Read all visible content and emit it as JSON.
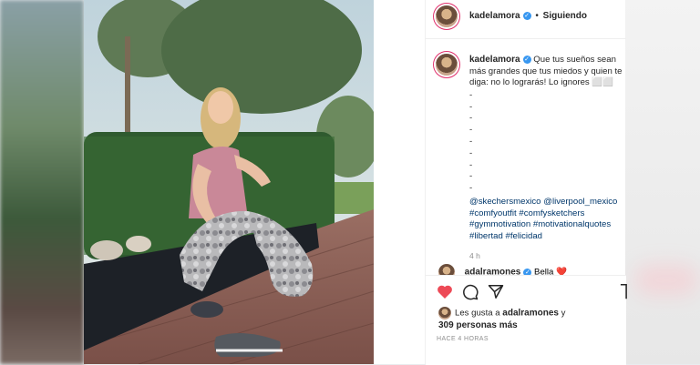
{
  "post": {
    "username": "kadelamora",
    "follow_status": "Siguiendo",
    "separator": "•",
    "verified_mark": "✓",
    "caption_text": "Que tus sueños sean más grandes que tus miedos y quien te diga: no lo lograrás! Lo ignores ⬜⬜",
    "dashes": [
      "-",
      "-",
      "-",
      "-",
      "-",
      "-",
      "-",
      "-",
      "-"
    ],
    "mentions": [
      "@skechersmexico",
      "@liverpool_mexico"
    ],
    "hashtags_line1": [
      "#comfyoutfit",
      "#comfysketchers"
    ],
    "hashtags_line2": [
      "#gymmotivation",
      "#motivationalquotes"
    ],
    "hashtags_line3": [
      "#libertad",
      "#felicidad"
    ],
    "time_ago_short": "4 h"
  },
  "comment": {
    "username": "adalramones",
    "text": "Bella",
    "emojis": "❤️"
  },
  "likes": {
    "prefix": "Les gusta a",
    "liker": "adalramones",
    "conj": "y",
    "others": "309 personas más"
  },
  "posted_ago": "HACE 4 HORAS",
  "icons": {
    "like": "heart-icon",
    "comment": "comment-icon",
    "share": "send-icon",
    "save": "bookmark-icon"
  },
  "colors": {
    "like_red": "#ed4956",
    "verified_blue": "#3897f0",
    "link_blue": "#00376b",
    "text": "#262626",
    "muted": "#8e8e8e"
  }
}
